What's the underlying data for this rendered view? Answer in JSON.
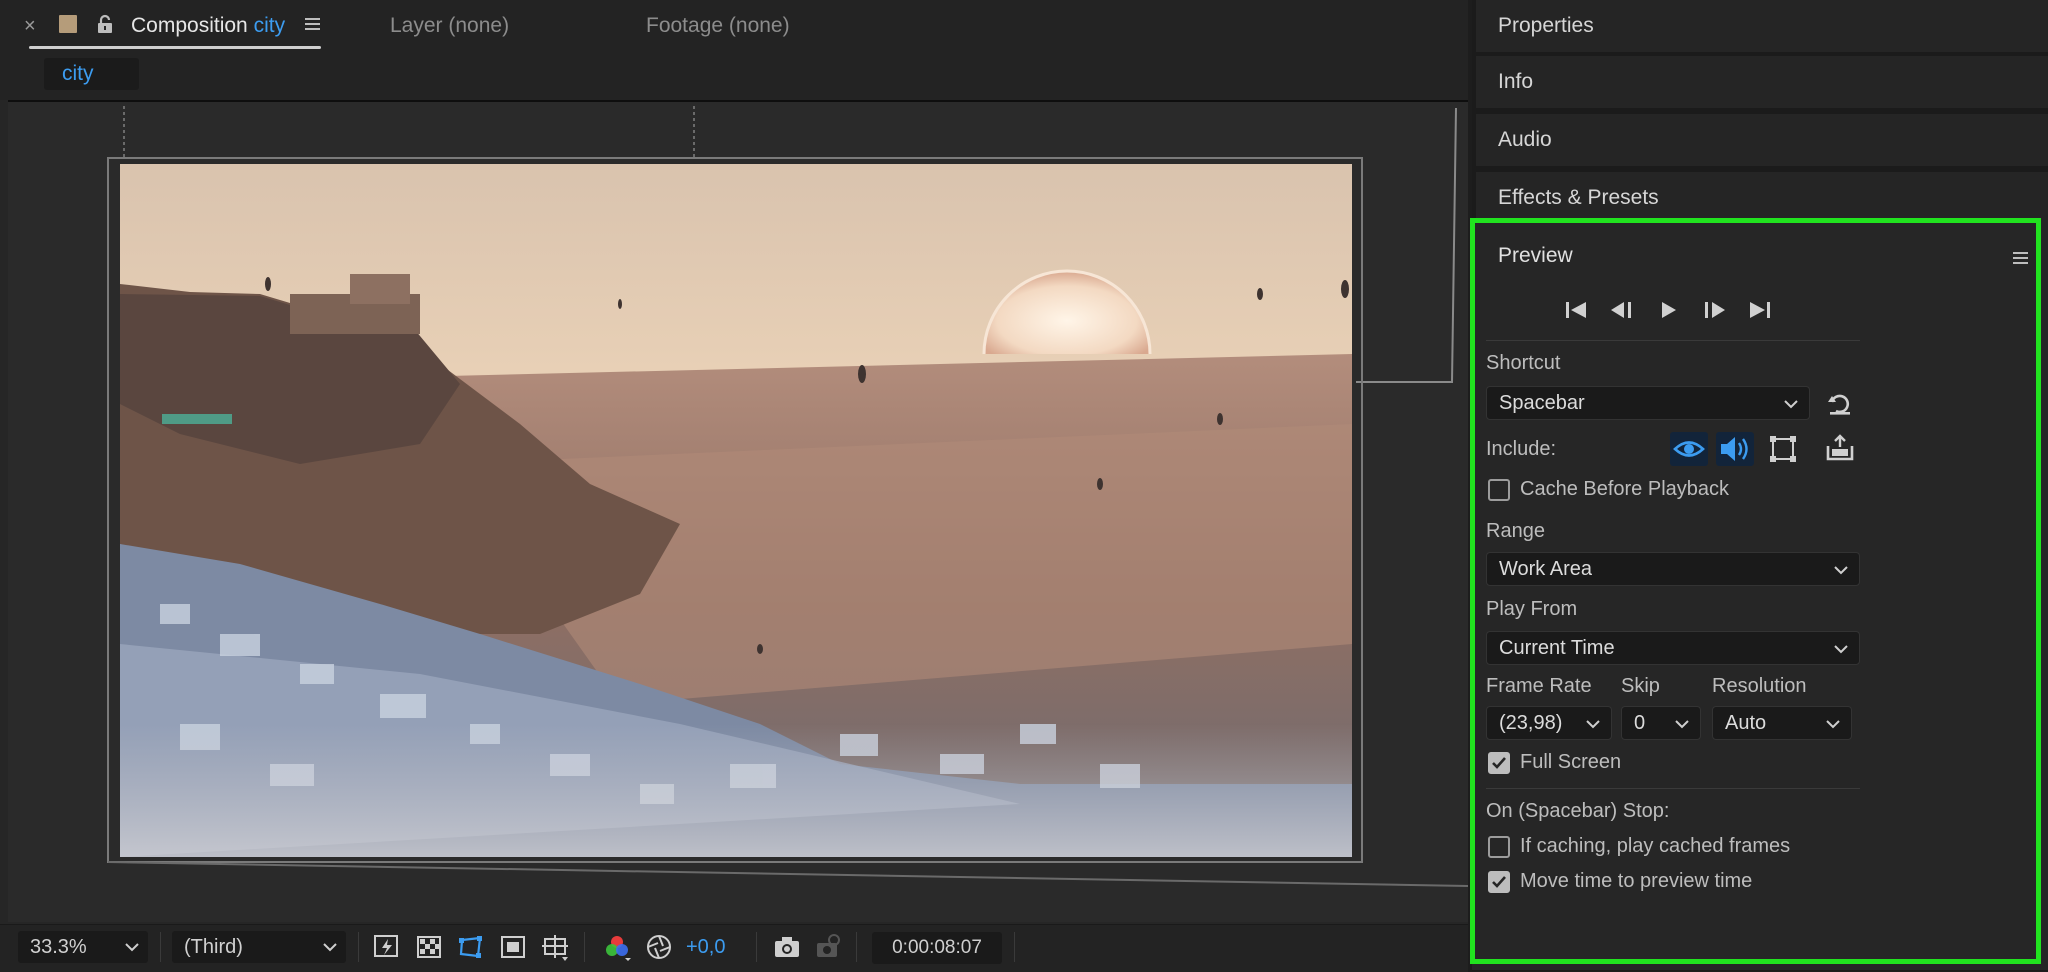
{
  "composition_tab": {
    "close_glyph": "×",
    "title_prefix": "Composition",
    "title_name": "city",
    "menu_icon": "hamburger-icon"
  },
  "other_tabs": {
    "layer": "Layer (none)",
    "footage": "Footage (none)"
  },
  "breadcrumb": "city",
  "viewer_toolbar": {
    "zoom": "33.3%",
    "resolution": "(Third)",
    "exposure": "+0,0",
    "timecode": "0:00:08:07"
  },
  "right_panels": [
    "Properties",
    "Info",
    "Audio",
    "Effects & Presets"
  ],
  "preview": {
    "title": "Preview",
    "shortcut_label": "Shortcut",
    "shortcut_value": "Spacebar",
    "include_label": "Include:",
    "cache_before_playback": "Cache Before Playback",
    "range_label": "Range",
    "range_value": "Work Area",
    "play_from_label": "Play From",
    "play_from_value": "Current Time",
    "frame_rate_label": "Frame Rate",
    "frame_rate_value": "(23,98)",
    "skip_label": "Skip",
    "skip_value": "0",
    "resolution_label": "Resolution",
    "resolution_value": "Auto",
    "full_screen": "Full Screen",
    "stop_label": "On (Spacebar) Stop:",
    "if_caching": "If caching, play cached frames",
    "move_time": "Move time to preview time",
    "checkboxes": {
      "cache_before_playback": false,
      "full_screen": true,
      "if_caching": false,
      "move_time": true
    }
  },
  "colors": {
    "accent_blue": "#3c9cf0",
    "highlight_green": "#21e31f",
    "panel_bg": "#262626"
  }
}
